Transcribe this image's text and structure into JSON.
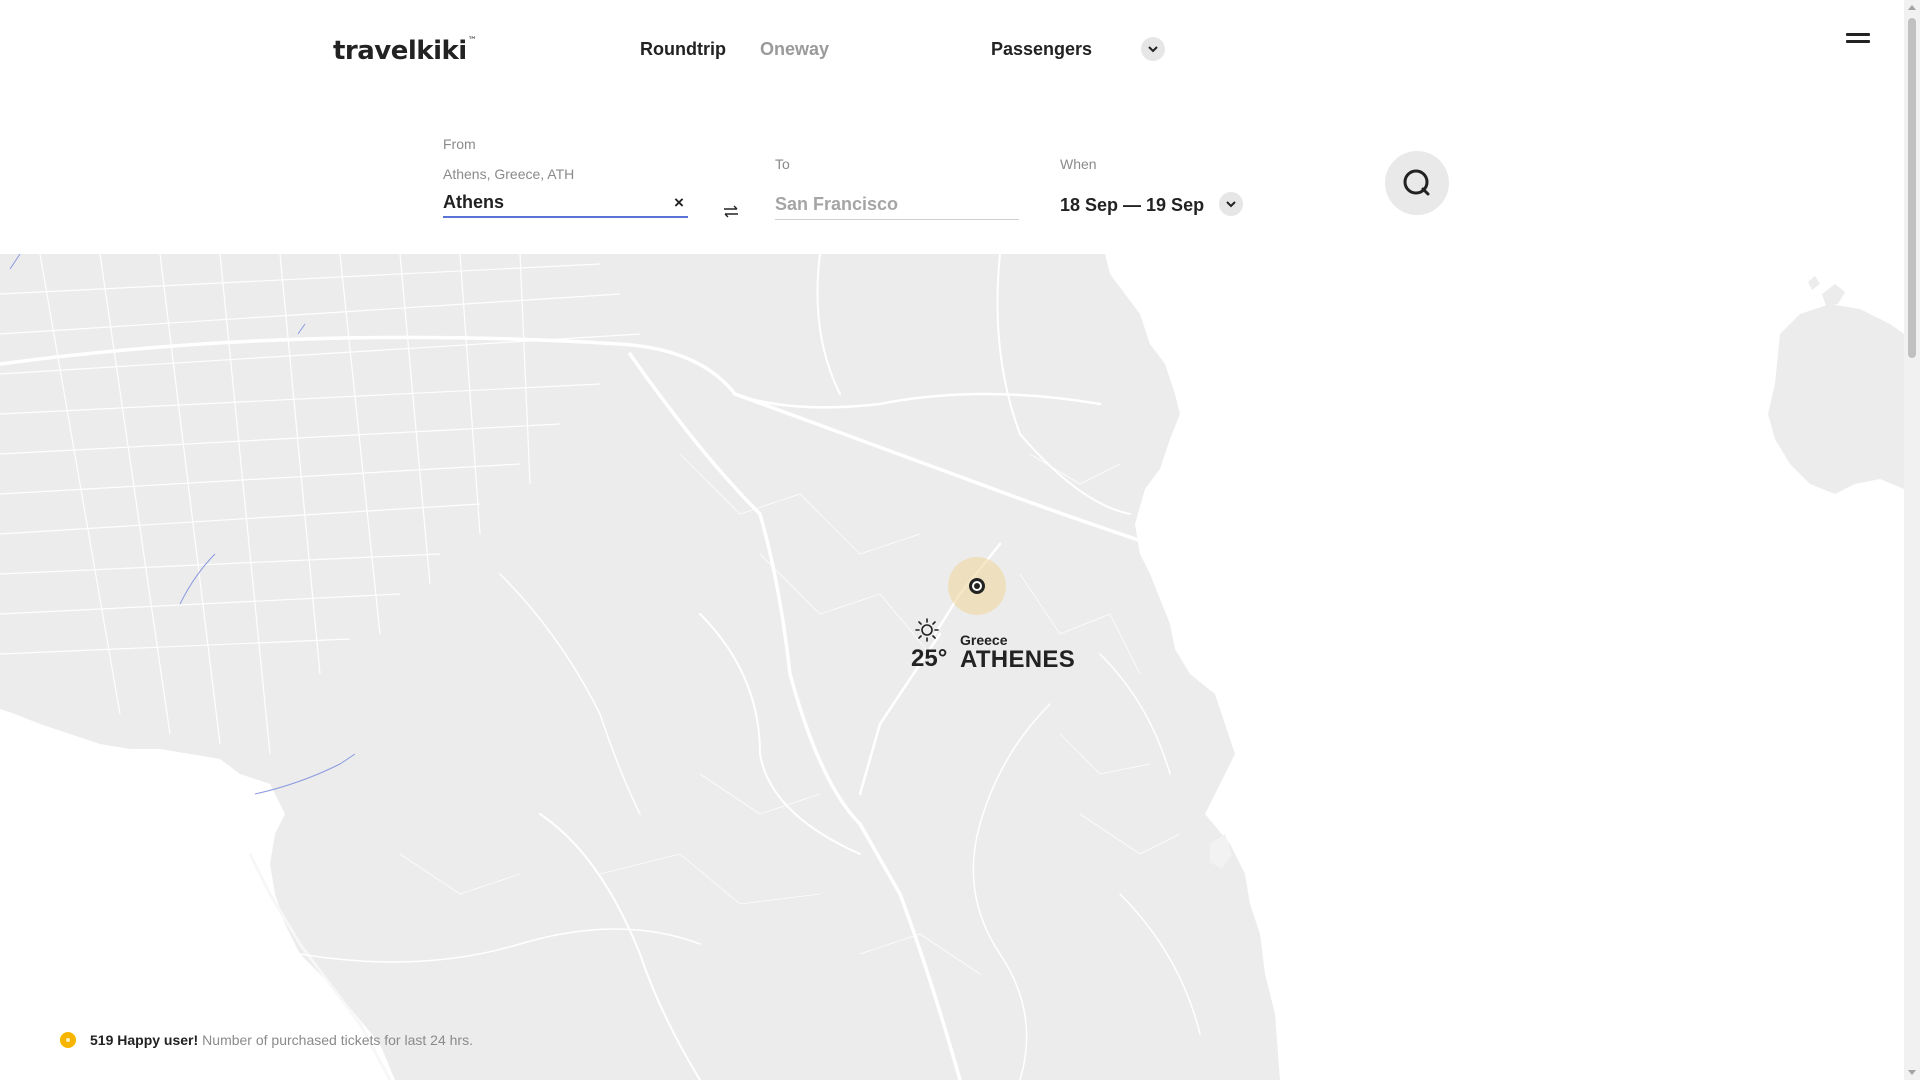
{
  "header": {
    "logo": "travelkiki",
    "logo_tm": "™",
    "tabs": [
      {
        "label": "Roundtrip",
        "active": true
      },
      {
        "label": "Oneway",
        "active": false
      }
    ],
    "passengers_label": "Passengers"
  },
  "search": {
    "from_label": "From",
    "from_detail": "Athens, Greece, ATH",
    "from_value": "Athens",
    "clear_symbol": "×",
    "to_label": "To",
    "to_placeholder": "San Francisco",
    "when_label": "When",
    "when_value": "18 Sep — 19 Sep"
  },
  "map": {
    "temperature": "25°",
    "country": "Greece",
    "city": "ATHENES",
    "weather_icon": "sun-icon",
    "marker_icon": "location-marker-icon"
  },
  "footer_stat": {
    "strong": "519 Happy user!",
    "text": "Number of purchased tickets for last 24 hrs."
  },
  "colors": {
    "land": "#ececec",
    "sea": "#ffffff",
    "roads": "#ffffff",
    "active_underline": "#5b73d6",
    "accent_dot": "#f7b500"
  }
}
